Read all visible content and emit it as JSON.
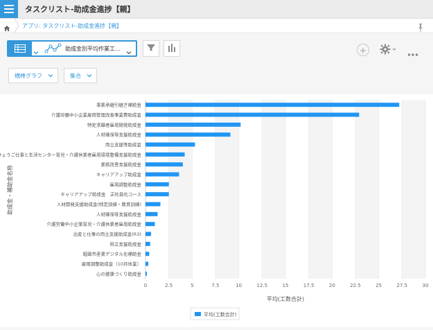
{
  "app": {
    "title": "タスクリスト-助成金進捗【親】"
  },
  "breadcrumb": {
    "text": "アプリ: タスクリスト-助成金進捗【親】"
  },
  "toolbar": {
    "view_label": "助成金別平均作業工…"
  },
  "filters": {
    "graph_type": "横棒グラフ",
    "aggregation": "集合"
  },
  "colors": {
    "accent": "#3498db",
    "bar": "#2196f3"
  },
  "chart_data": {
    "type": "bar",
    "orientation": "horizontal",
    "categories": [
      "事業承継引継ぎ補助金",
      "介護労働中小企業雇用管理改善事業費助成金",
      "特定求職者雇用開発助成金",
      "人材確保等支援助成金",
      "両立支援等助成金",
      "ひょうご仕事と生活センター育児・介護休業者雇用環境整備支援助成金",
      "業務改善支援助成金",
      "キャリアアップ助成金",
      "雇用調整助成金",
      "キャリアアップ助成金　正社員化コース",
      "人材開発支援助成金(特定訓練・教育訓練)",
      "人材確保等支援助成金",
      "介護労働中小企業育児・介護休業者雇用助成金",
      "出産と仕事の両立支援助成金(R3)",
      "両立支援助成金",
      "姫路市産業デジタル化補助金",
      "雇用調整助成金（10月休業）",
      "心の健康づくり助成金"
    ],
    "values": [
      27.2,
      22.9,
      10.2,
      9.1,
      5.3,
      4.2,
      4.0,
      3.6,
      2.5,
      2.5,
      1.6,
      1.3,
      1.0,
      0.6,
      0.5,
      0.4,
      0.3,
      0.15
    ],
    "x_ticks": [
      "0",
      "2.5",
      "5",
      "7.5",
      "10",
      "12.5",
      "15",
      "17.5",
      "20",
      "22.5",
      "25",
      "27.5",
      "30"
    ],
    "xlim": [
      0,
      30
    ],
    "xlabel": "平均(工数合計)",
    "ylabel": "助成金・補助金名称",
    "legend": "平均(工数合計)",
    "legend_position": "bottom",
    "grid": true
  }
}
